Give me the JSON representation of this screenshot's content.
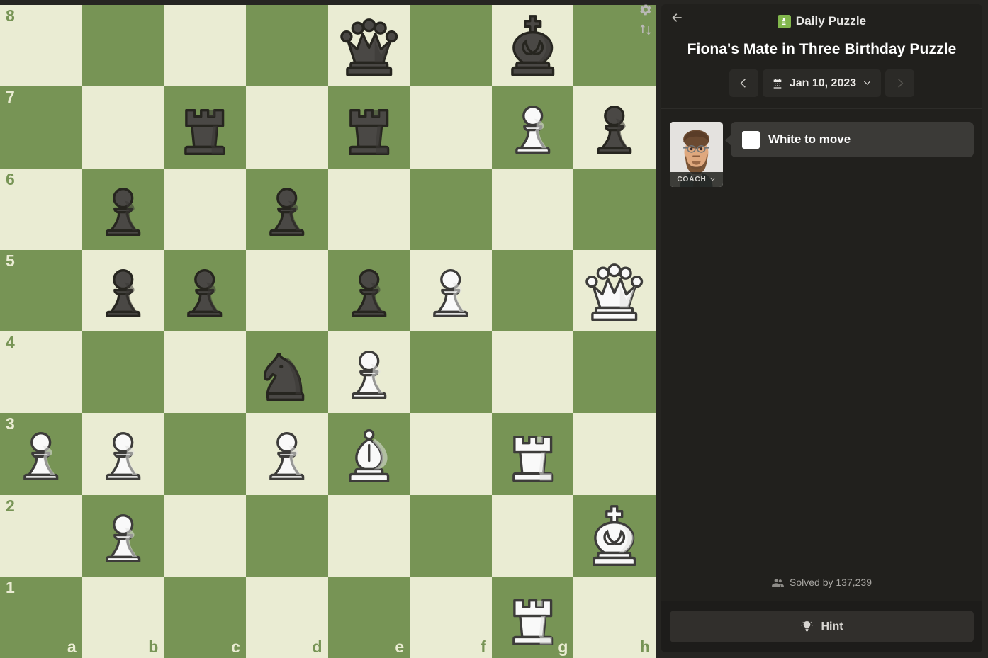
{
  "board": {
    "light_square_color": "#eaecd3",
    "dark_square_color": "#779455",
    "files": [
      "a",
      "b",
      "c",
      "d",
      "e",
      "f",
      "g",
      "h"
    ],
    "ranks": [
      "8",
      "7",
      "6",
      "5",
      "4",
      "3",
      "2",
      "1"
    ],
    "orientation": "white",
    "tools": [
      {
        "name": "settings-icon",
        "label": "Settings"
      },
      {
        "name": "flip-board-icon",
        "label": "Flip board"
      }
    ],
    "pieces": [
      {
        "square": "e8",
        "color": "black",
        "type": "queen"
      },
      {
        "square": "g8",
        "color": "black",
        "type": "king"
      },
      {
        "square": "c7",
        "color": "black",
        "type": "rook"
      },
      {
        "square": "e7",
        "color": "black",
        "type": "rook"
      },
      {
        "square": "g7",
        "color": "white",
        "type": "pawn"
      },
      {
        "square": "h7",
        "color": "black",
        "type": "pawn"
      },
      {
        "square": "b6",
        "color": "black",
        "type": "pawn"
      },
      {
        "square": "d6",
        "color": "black",
        "type": "pawn"
      },
      {
        "square": "b5",
        "color": "black",
        "type": "pawn"
      },
      {
        "square": "c5",
        "color": "black",
        "type": "pawn"
      },
      {
        "square": "e5",
        "color": "black",
        "type": "pawn"
      },
      {
        "square": "f5",
        "color": "white",
        "type": "pawn"
      },
      {
        "square": "h5",
        "color": "white",
        "type": "queen"
      },
      {
        "square": "d4",
        "color": "black",
        "type": "knight"
      },
      {
        "square": "e4",
        "color": "white",
        "type": "pawn"
      },
      {
        "square": "a3",
        "color": "white",
        "type": "pawn"
      },
      {
        "square": "b3",
        "color": "white",
        "type": "pawn"
      },
      {
        "square": "d3",
        "color": "white",
        "type": "pawn"
      },
      {
        "square": "e3",
        "color": "white",
        "type": "bishop"
      },
      {
        "square": "g3",
        "color": "white",
        "type": "rook"
      },
      {
        "square": "b2",
        "color": "white",
        "type": "pawn"
      },
      {
        "square": "h2",
        "color": "white",
        "type": "king"
      },
      {
        "square": "g1",
        "color": "white",
        "type": "rook"
      }
    ]
  },
  "panel": {
    "back_label": "Back",
    "header_icon": "daily-puzzle-icon",
    "header_title": "Daily Puzzle",
    "puzzle_title": "Fiona's Mate in Three Birthday Puzzle",
    "date": {
      "prev_label": "Previous day",
      "next_label": "Next day",
      "next_disabled": true,
      "value": "Jan 10, 2023"
    },
    "coach": {
      "tag_label": "COACH",
      "message": "White to move",
      "turn_color": "#ffffff"
    },
    "solved": {
      "text": "Solved by 137,239"
    },
    "hint_button": {
      "label": "Hint"
    },
    "accent_color": "#81b64c"
  }
}
